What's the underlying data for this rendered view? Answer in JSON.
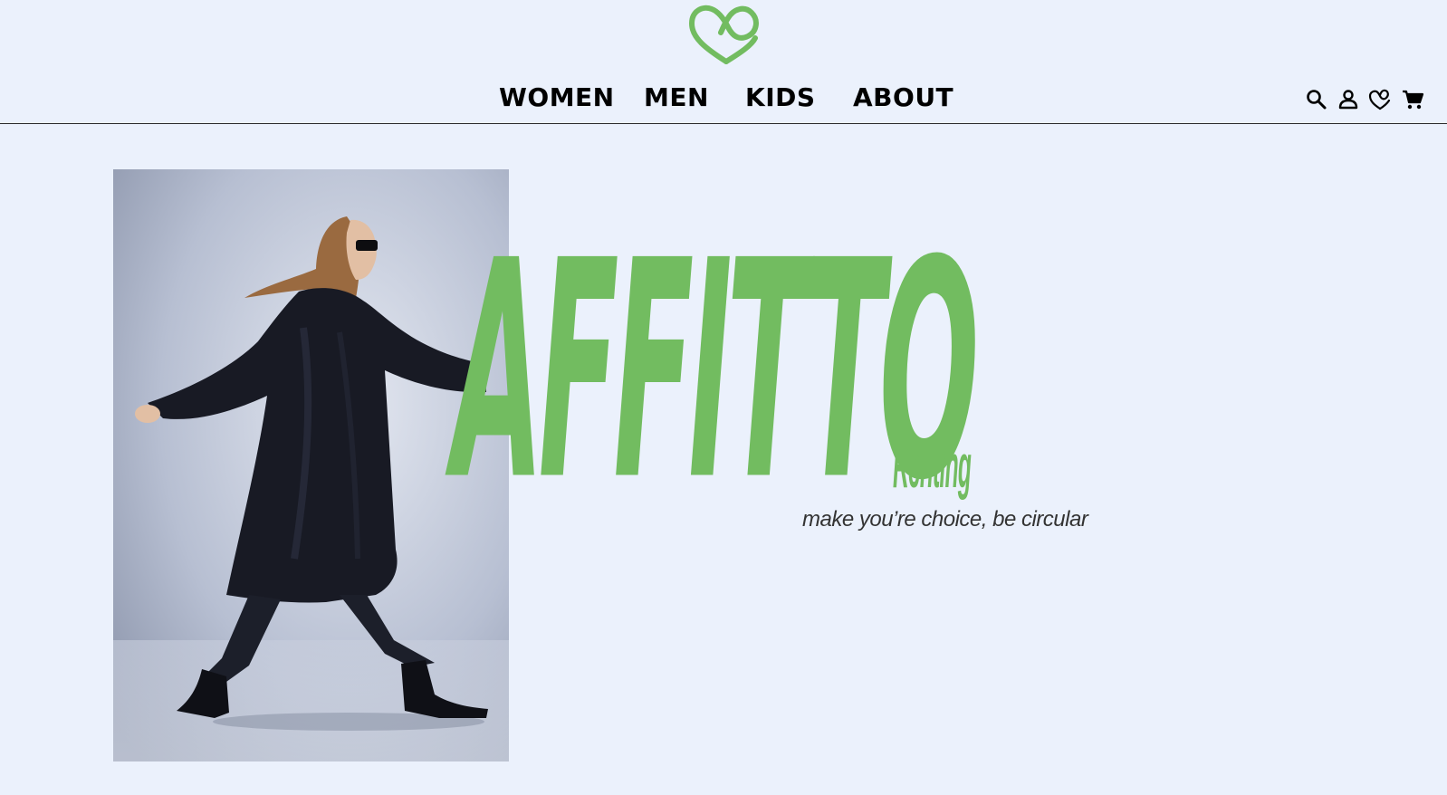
{
  "brand": {
    "logo_icon": "heart-infinity-icon",
    "wordmark": "AFFITTO",
    "wordmark_sub": "Renting",
    "tagline": "make you’re choice, be circular",
    "accent_color": "#72bc60"
  },
  "nav": {
    "items": [
      {
        "label": "WOMEN"
      },
      {
        "label": "MEN"
      },
      {
        "label": "KIDS"
      },
      {
        "label": "ABOUT"
      }
    ]
  },
  "header_icons": [
    {
      "name": "search-icon"
    },
    {
      "name": "account-icon"
    },
    {
      "name": "wishlist-icon"
    },
    {
      "name": "cart-icon"
    }
  ],
  "colors": {
    "background": "#ebf1fc",
    "text": "#000000"
  }
}
